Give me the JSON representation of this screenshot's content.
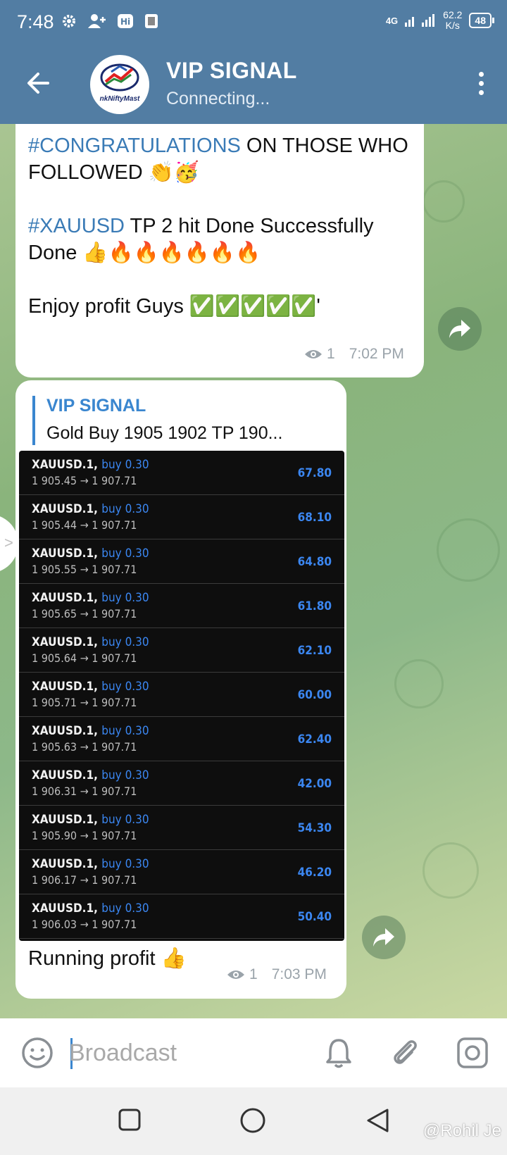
{
  "status_bar": {
    "time": "7:48",
    "network": "4G",
    "speed_value": "62.2",
    "speed_unit": "K/s",
    "battery": "48"
  },
  "header": {
    "title": "VIP SIGNAL",
    "subtitle": "Connecting...",
    "avatar_text": "nkNiftyMast"
  },
  "message1": {
    "tag1": "#CONGRATULATIONS",
    "line1_rest": " ON THOSE WHO FOLLOWED ",
    "emoji1": "👏🥳",
    "tag2": "#XAUUSD",
    "line2_rest": "  TP 2 hit   Done Successfully    Done ",
    "emoji2": "👍🔥🔥🔥🔥🔥🔥",
    "line3": "Enjoy profit Guys ",
    "emoji3": "✅✅✅✅✅'",
    "views": "1",
    "time": "7:02 PM"
  },
  "message2": {
    "reply_name": "VIP SIGNAL",
    "reply_text": "Gold Buy 1905      1902  TP 190...",
    "trades": [
      {
        "symbol": "XAUUSD.1,",
        "action": "buy 0.30",
        "prices": "1 905.45 → 1 907.71",
        "profit": "67.80"
      },
      {
        "symbol": "XAUUSD.1,",
        "action": "buy 0.30",
        "prices": "1 905.44 → 1 907.71",
        "profit": "68.10"
      },
      {
        "symbol": "XAUUSD.1,",
        "action": "buy 0.30",
        "prices": "1 905.55 → 1 907.71",
        "profit": "64.80"
      },
      {
        "symbol": "XAUUSD.1,",
        "action": "buy 0.30",
        "prices": "1 905.65 → 1 907.71",
        "profit": "61.80"
      },
      {
        "symbol": "XAUUSD.1,",
        "action": "buy 0.30",
        "prices": "1 905.64 → 1 907.71",
        "profit": "62.10"
      },
      {
        "symbol": "XAUUSD.1,",
        "action": "buy 0.30",
        "prices": "1 905.71 → 1 907.71",
        "profit": "60.00"
      },
      {
        "symbol": "XAUUSD.1,",
        "action": "buy 0.30",
        "prices": "1 905.63 → 1 907.71",
        "profit": "62.40"
      },
      {
        "symbol": "XAUUSD.1,",
        "action": "buy 0.30",
        "prices": "1 906.31 → 1 907.71",
        "profit": "42.00"
      },
      {
        "symbol": "XAUUSD.1,",
        "action": "buy 0.30",
        "prices": "1 905.90 → 1 907.71",
        "profit": "54.30"
      },
      {
        "symbol": "XAUUSD.1,",
        "action": "buy 0.30",
        "prices": "1 906.17 → 1 907.71",
        "profit": "46.20"
      },
      {
        "symbol": "XAUUSD.1,",
        "action": "buy 0.30",
        "prices": "1 906.03 → 1 907.71",
        "profit": "50.40"
      }
    ],
    "text": "Running profit ",
    "emoji": "👍",
    "views": "1",
    "time": "7:03 PM"
  },
  "input": {
    "placeholder": "Broadcast"
  },
  "watermark": "@Rohil Je",
  "colors": {
    "header": "#527da3",
    "link": "#3a7bb6",
    "trade_blue": "#3b86f0"
  }
}
